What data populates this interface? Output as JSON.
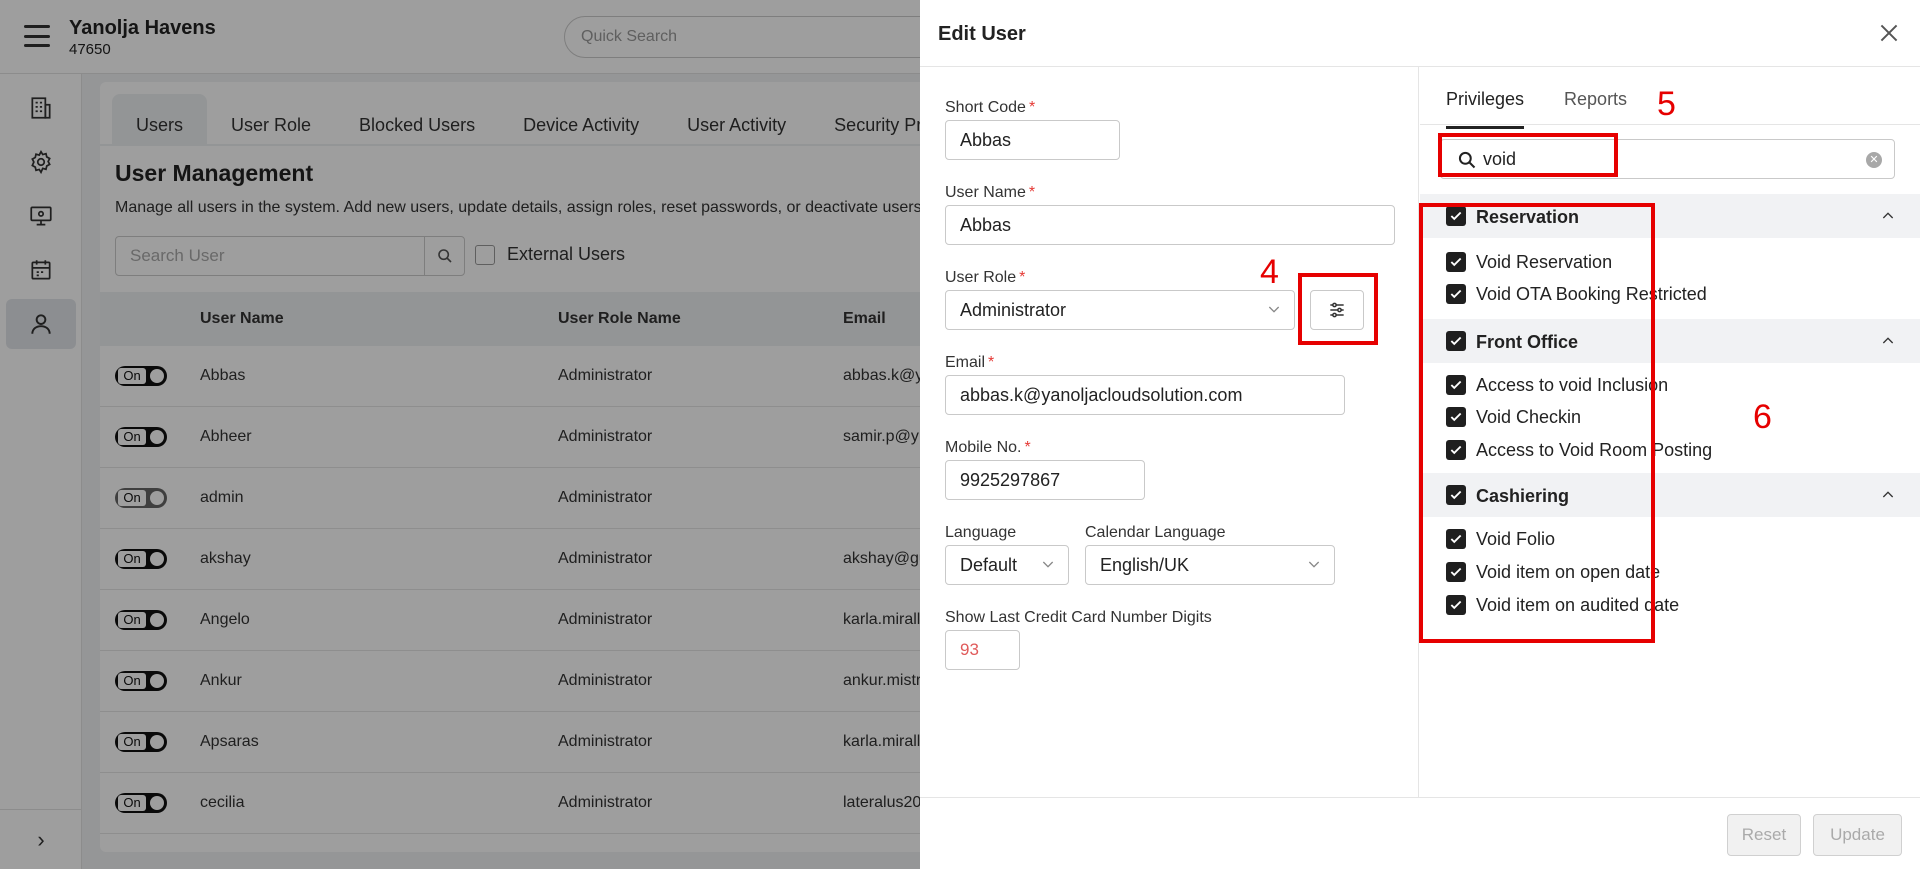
{
  "app": {
    "property_name": "Yanolja Havens",
    "property_code": "47650",
    "quick_search_placeholder": "Quick Search"
  },
  "tabs": [
    "Users",
    "User Role",
    "Blocked Users",
    "Device Activity",
    "User Activity",
    "Security Pro"
  ],
  "user_management": {
    "title": "User Management",
    "description": "Manage all users in the system. Add new users, update details, assign roles, reset passwords, or deactivate users",
    "search_placeholder": "Search User",
    "external_users_label": "External Users",
    "columns": [
      "User Name",
      "User Role Name",
      "Email"
    ],
    "rows": [
      {
        "toggle": "On",
        "name": "Abbas",
        "role": "Administrator",
        "email": "abbas.k@y"
      },
      {
        "toggle": "On",
        "name": "Abheer",
        "role": "Administrator",
        "email": "samir.p@y"
      },
      {
        "toggle": "On",
        "name": "admin",
        "role": "Administrator",
        "email": ""
      },
      {
        "toggle": "On",
        "name": "akshay",
        "role": "Administrator",
        "email": "akshay@gu"
      },
      {
        "toggle": "On",
        "name": "Angelo",
        "role": "Administrator",
        "email": "karla.mirall"
      },
      {
        "toggle": "On",
        "name": "Ankur",
        "role": "Administrator",
        "email": "ankur.mistr"
      },
      {
        "toggle": "On",
        "name": "Apsaras",
        "role": "Administrator",
        "email": "karla.mirall"
      },
      {
        "toggle": "On",
        "name": "cecilia",
        "role": "Administrator",
        "email": "lateralus20"
      }
    ]
  },
  "edit_user": {
    "title": "Edit User",
    "short_code": {
      "label": "Short Code",
      "value": "Abbas"
    },
    "user_name": {
      "label": "User Name",
      "value": "Abbas"
    },
    "user_role": {
      "label": "User Role",
      "value": "Administrator"
    },
    "email": {
      "label": "Email",
      "value": "abbas.k@yanoljacloudsolution.com"
    },
    "mobile": {
      "label": "Mobile No.",
      "value": "9925297867"
    },
    "language": {
      "label": "Language",
      "value": "Default"
    },
    "calendar_language": {
      "label": "Calendar Language",
      "value": "English/UK"
    },
    "cc_digits": {
      "label": "Show Last Credit Card Number Digits",
      "value": "93"
    },
    "required_mark": "*",
    "reset_label": "Reset",
    "update_label": "Update"
  },
  "privileges_panel": {
    "tabs": [
      "Privileges",
      "Reports"
    ],
    "search_value": "void",
    "groups": [
      {
        "name": "Reservation",
        "items": [
          "Void Reservation",
          "Void OTA Booking Restricted"
        ]
      },
      {
        "name": "Front Office",
        "items": [
          "Access to void Inclusion",
          "Void Checkin",
          "Access to Void Room Posting"
        ]
      },
      {
        "name": "Cashiering",
        "items": [
          "Void Folio",
          "Void item on open date",
          "Void item on audited date"
        ]
      }
    ]
  },
  "annotations": {
    "a4": "4",
    "a5": "5",
    "a6": "6"
  },
  "colors": {
    "annotation": "#e60000",
    "overlay": "rgba(0,0,0,0.38)",
    "checkbox": "#1f1f1f"
  }
}
